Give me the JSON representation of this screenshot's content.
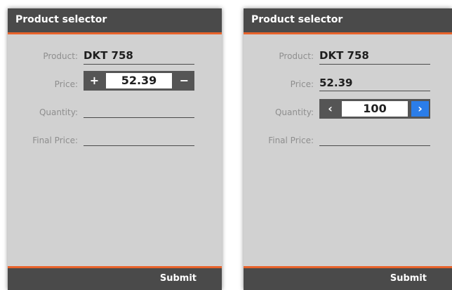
{
  "panels": [
    {
      "title": "Product selector",
      "fields": {
        "product_label": "Product:",
        "product_value": "DKT 758",
        "price_label": "Price:",
        "price_value": "52.39",
        "price_plus": "+",
        "price_minus": "−",
        "quantity_label": "Quantity:",
        "final_price_label": "Final Price:"
      },
      "submit_label": "Submit"
    },
    {
      "title": "Product selector",
      "fields": {
        "product_label": "Product:",
        "product_value": "DKT 758",
        "price_label": "Price:",
        "price_value": "52.39",
        "quantity_label": "Quantity:",
        "quantity_value": "100",
        "quantity_prev": "‹",
        "quantity_next": "›",
        "final_price_label": "Final Price:"
      },
      "submit_label": "Submit"
    }
  ],
  "colors": {
    "panel_bg": "#d1d1d1",
    "bar_bg": "#4a4a4a",
    "accent": "#e8632b",
    "next_button": "#2b7de8"
  }
}
